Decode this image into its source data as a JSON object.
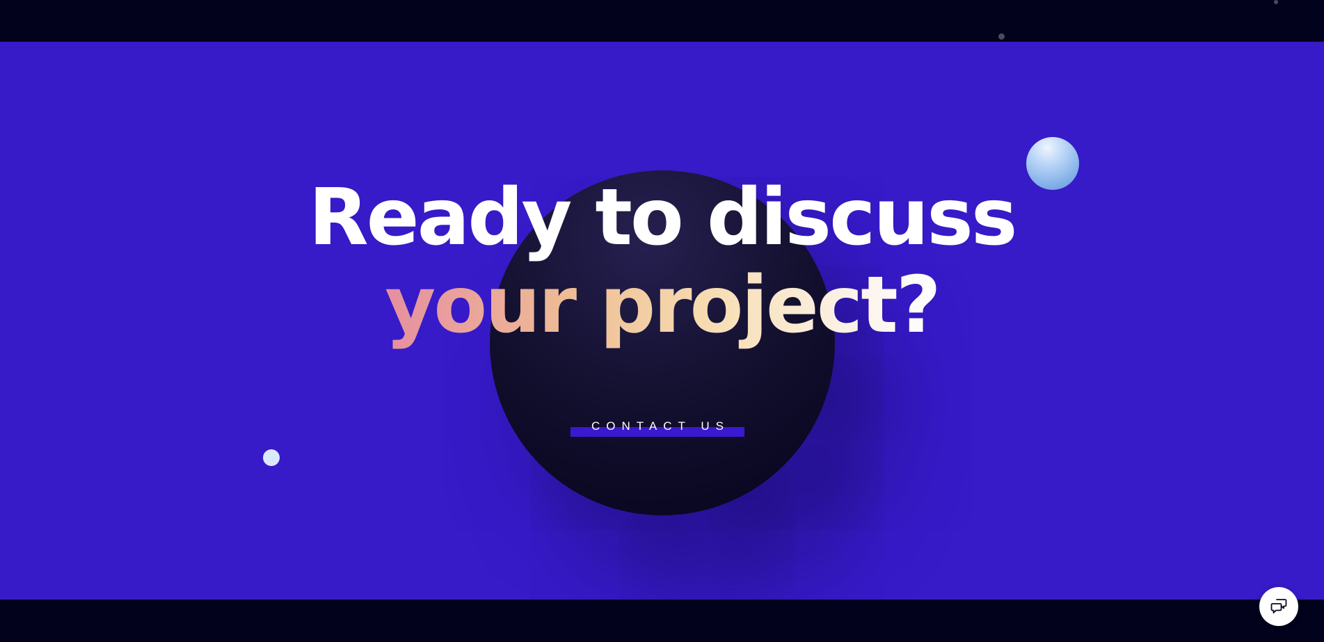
{
  "headline": {
    "line1": "Ready to discuss",
    "line2": "your project?"
  },
  "cta": {
    "label": "CONTACT US"
  },
  "chat": {
    "icon": "chat-bubbles-icon"
  },
  "colors": {
    "hero_background": "#371ac8",
    "bars_background": "#03021c",
    "cta_underline": "#3a19d0",
    "headline_white": "#ffffff",
    "gradient_start": "#e58f9f",
    "gradient_end": "#ffffff"
  }
}
